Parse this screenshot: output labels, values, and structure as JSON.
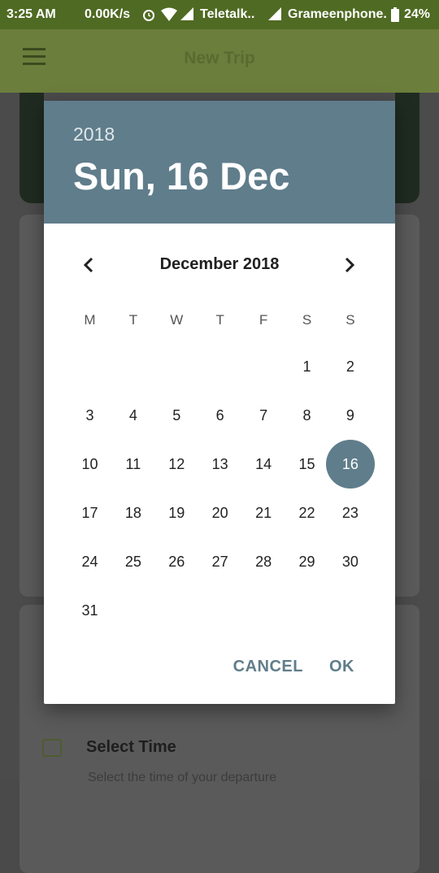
{
  "status_bar": {
    "time": "3:25 AM",
    "speed": "0.00K/s",
    "carrier1": "Teletalk..",
    "carrier2": "Grameenphone.",
    "battery": "24%"
  },
  "app_bar": {
    "title": "New Trip"
  },
  "background": {
    "select_time_label": "Select Time",
    "select_time_subtitle": "Select the time of your departure"
  },
  "dialog": {
    "year": "2018",
    "selected_date": "Sun, 16 Dec",
    "month_label": "December 2018",
    "weekdays": [
      "M",
      "T",
      "W",
      "T",
      "F",
      "S",
      "S"
    ],
    "days": [
      "1",
      "2",
      "3",
      "4",
      "5",
      "6",
      "7",
      "8",
      "9",
      "10",
      "11",
      "12",
      "13",
      "14",
      "15",
      "16",
      "17",
      "18",
      "19",
      "20",
      "21",
      "22",
      "23",
      "24",
      "25",
      "26",
      "27",
      "28",
      "29",
      "30",
      "31"
    ],
    "selected_day": "16",
    "cancel_label": "CANCEL",
    "ok_label": "OK"
  },
  "colors": {
    "header": "#607d8b",
    "appbar": "#6b7e3c"
  }
}
